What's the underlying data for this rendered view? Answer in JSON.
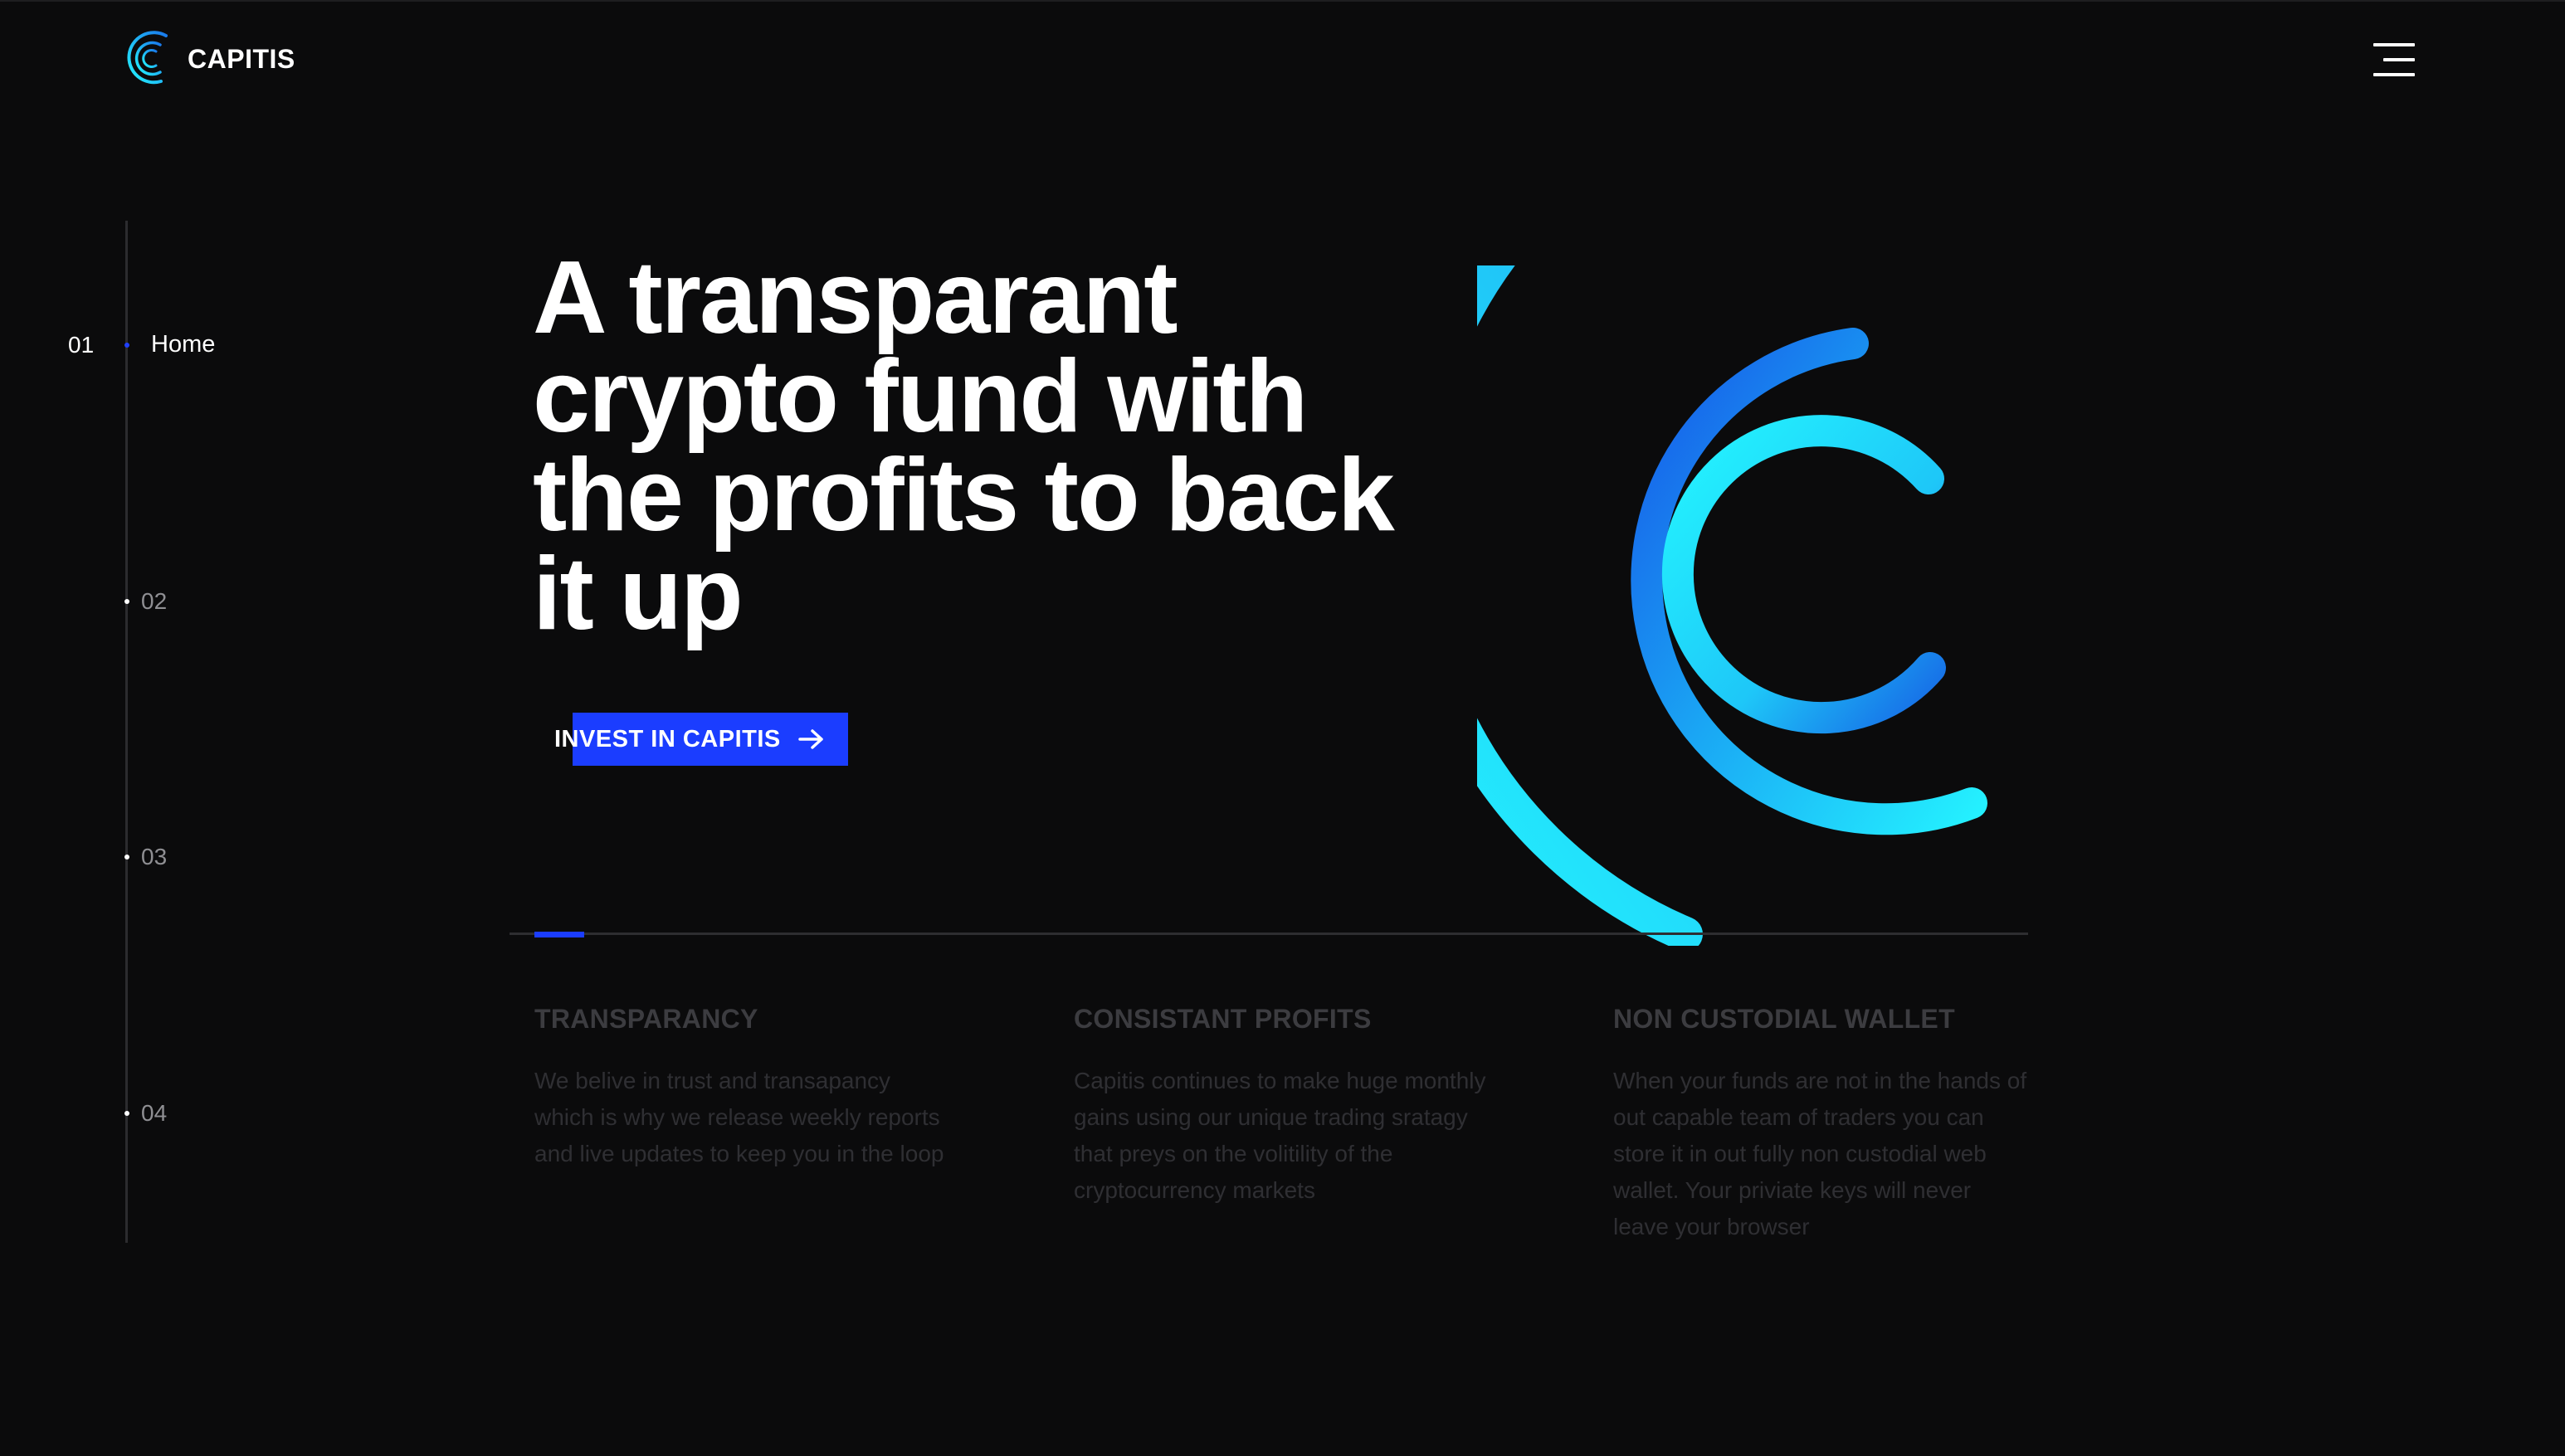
{
  "header": {
    "brand_name": "CAPITIS",
    "logo_icon": "capitis-c-logo-icon",
    "menu_icon": "hamburger-menu-icon"
  },
  "side_nav": {
    "items": [
      {
        "number": "01",
        "label": "Home",
        "active": true
      },
      {
        "number": "02",
        "label": "",
        "active": false
      },
      {
        "number": "03",
        "label": "",
        "active": false
      },
      {
        "number": "04",
        "label": "",
        "active": false
      }
    ]
  },
  "hero": {
    "title": "A transparant crypto fund with the profits to back it up",
    "cta_label": "INVEST IN CAPITIS",
    "cta_icon": "arrow-right-icon"
  },
  "features": [
    {
      "title": "TRANSPARANCY",
      "body": "We belive in trust and transapancy which is why we release weekly reports and live updates to keep you in the loop"
    },
    {
      "title": "CONSISTANT PROFITS",
      "body": "Capitis continues to make huge monthly gains using our unique trading sratagy that preys on the volitility of the cryptocurrency markets"
    },
    {
      "title": "NON CUSTODIAL WALLET",
      "body": "When your funds are not in the hands of out capable team of traders you can store it in out fully non custodial web wallet. Your priviate keys will never leave your browser"
    }
  ],
  "colors": {
    "background": "#0b0b0c",
    "accent_blue": "#1b3dff",
    "gradient_cyan": "#24f4ff",
    "gradient_blue": "#1560e0",
    "text_white": "#ffffff",
    "muted_text": "#3c3c40"
  }
}
